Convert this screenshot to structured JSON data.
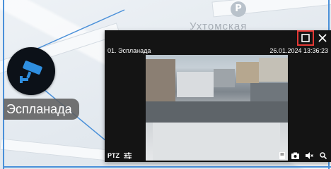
{
  "map": {
    "street_label": "Ухтомская",
    "pin_glyph": "P"
  },
  "camera": {
    "label": "Эспланада",
    "marker_color": "#0c1118",
    "icon_color": "#2f8fe0",
    "icon": "cctv-camera-icon"
  },
  "popup": {
    "title": "01. Эспланада",
    "datetime": "26.01.2024 13:36:23",
    "buttons": {
      "maximize": "maximize-icon",
      "close": "close-icon"
    },
    "controls": {
      "ptz": "PTZ",
      "settings_icon": "sliders-icon",
      "right_icons": [
        "archive-icon",
        "camera-snapshot-icon",
        "volume-mute-icon",
        "zoom-icon"
      ]
    },
    "highlight_color": "#e53935"
  }
}
